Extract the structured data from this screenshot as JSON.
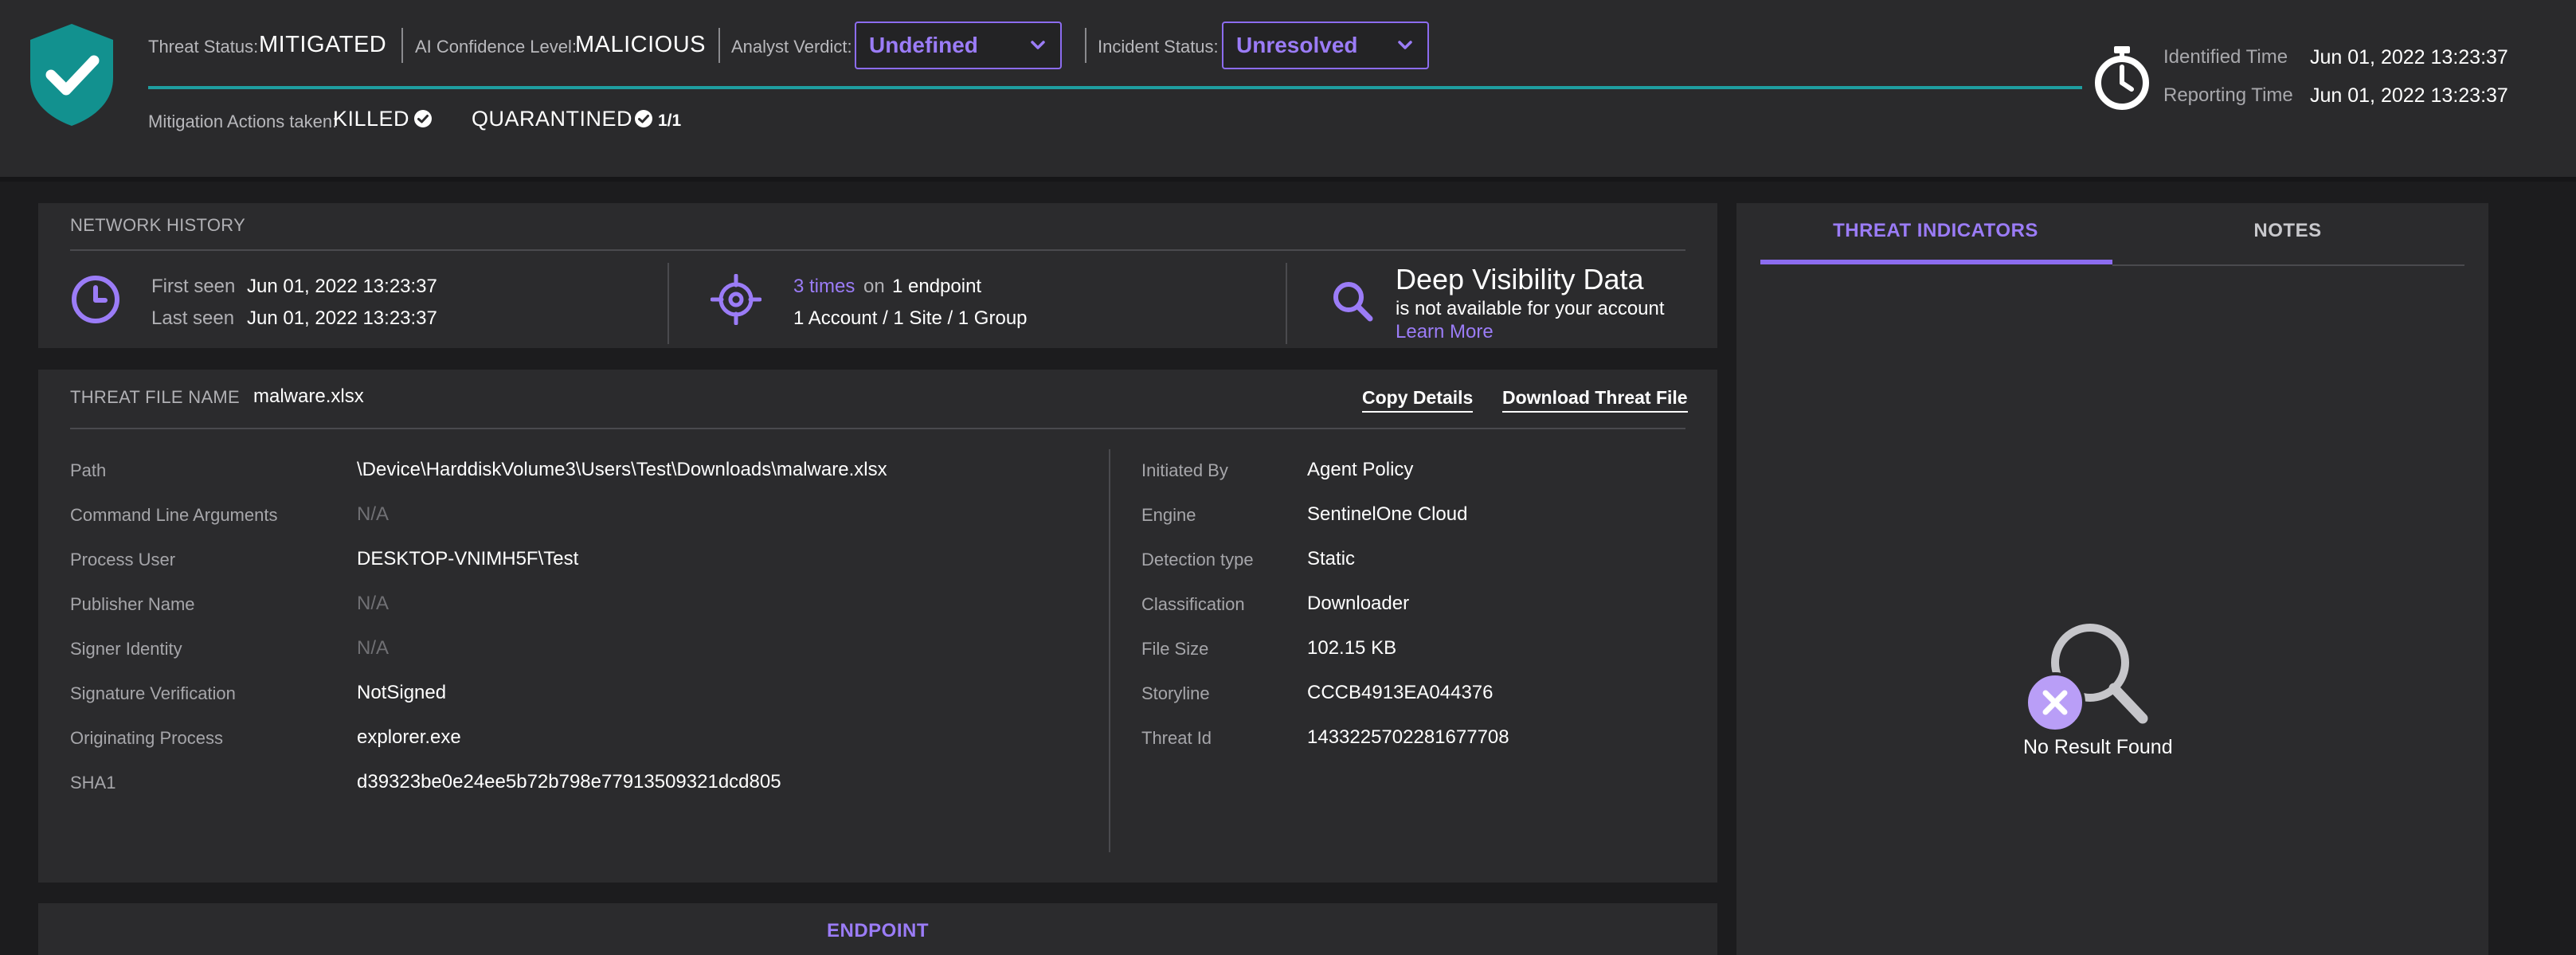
{
  "header": {
    "threat_status": {
      "label": "Threat Status:",
      "value": "MITIGATED"
    },
    "ai_confidence": {
      "label": "AI Confidence Level:",
      "value": "MALICIOUS"
    },
    "analyst_verdict": {
      "label": "Analyst Verdict:",
      "value": "Undefined"
    },
    "incident_status": {
      "label": "Incident Status:",
      "value": "Unresolved"
    },
    "mitigation": {
      "label": "Mitigation Actions taken:",
      "actions": [
        {
          "name": "KILLED",
          "count": ""
        },
        {
          "name": "QUARANTINED",
          "count": "1/1"
        }
      ]
    },
    "identified": {
      "label": "Identified Time",
      "value": "Jun 01, 2022 13:23:37"
    },
    "reporting": {
      "label": "Reporting Time",
      "value": "Jun 01, 2022 13:23:37"
    },
    "icons": {
      "shield": "shield-check-icon",
      "timer": "stopwatch-icon"
    },
    "colors": {
      "shield": "#12918f",
      "accent": "#9b7cf7",
      "teal_line": "#1e9ea0"
    }
  },
  "network_history": {
    "title": "NETWORK HISTORY",
    "first_seen_label": "First seen",
    "first_seen_value": "Jun 01, 2022 13:23:37",
    "last_seen_label": "Last seen",
    "last_seen_value": "Jun 01, 2022 13:23:37",
    "times": "3 times",
    "on_text": "on",
    "endpoints": "1 endpoint",
    "scope": "1 Account / 1 Site / 1 Group",
    "deep_title": "Deep Visibility Data",
    "deep_text": "is not available for your account",
    "learn_more": "Learn More"
  },
  "threat_file": {
    "label": "THREAT FILE NAME",
    "name": "malware.xlsx",
    "copy_details": "Copy Details",
    "download": "Download Threat File",
    "left_fields": [
      {
        "label": "Path",
        "value": "\\Device\\HarddiskVolume3\\Users\\Test\\Downloads\\malware.xlsx"
      },
      {
        "label": "Command Line Arguments",
        "value": "N/A"
      },
      {
        "label": "Process User",
        "value": "DESKTOP-VNIMH5F\\Test"
      },
      {
        "label": "Publisher Name",
        "value": "N/A"
      },
      {
        "label": "Signer Identity",
        "value": "N/A"
      },
      {
        "label": "Signature Verification",
        "value": "NotSigned"
      },
      {
        "label": "Originating Process",
        "value": "explorer.exe"
      },
      {
        "label": "SHA1",
        "value": "d39323be0e24ee5b72b798e77913509321dcd805"
      }
    ],
    "right_fields": [
      {
        "label": "Initiated By",
        "value": "Agent Policy"
      },
      {
        "label": "Engine",
        "value": "SentinelOne Cloud"
      },
      {
        "label": "Detection type",
        "value": "Static"
      },
      {
        "label": "Classification",
        "value": "Downloader"
      },
      {
        "label": "File Size",
        "value": "102.15 KB"
      },
      {
        "label": "Storyline",
        "value": "CCCB4913EA044376"
      },
      {
        "label": "Threat Id",
        "value": "1433225702281677708"
      }
    ]
  },
  "endpoint": {
    "title": "ENDPOINT"
  },
  "side_panel": {
    "tabs": [
      "THREAT INDICATORS",
      "NOTES"
    ],
    "active_tab": "THREAT INDICATORS",
    "empty_text": "No Result Found"
  }
}
